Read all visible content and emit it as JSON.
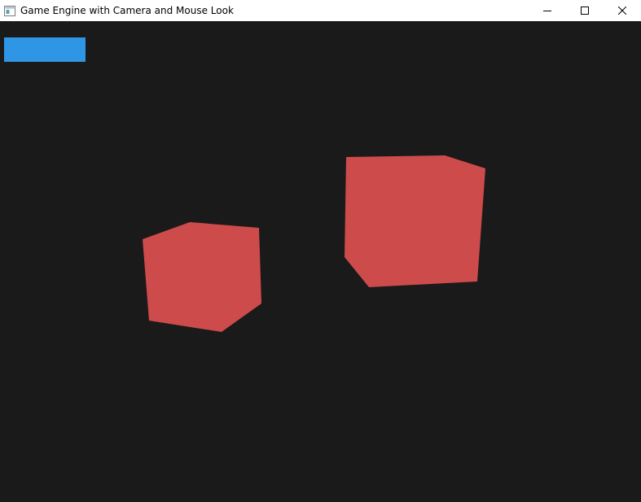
{
  "window": {
    "title": "Game Engine with Camera and Mouse Look",
    "icon": "app-window-icon",
    "controls": [
      "minimize-icon",
      "maximize-icon",
      "close-icon"
    ]
  },
  "scene": {
    "background_color": "#1a1a1a",
    "hud_bar_color": "#2f96e6",
    "cube_color": "#cd4b4b",
    "objects": [
      "cube",
      "cube"
    ]
  }
}
